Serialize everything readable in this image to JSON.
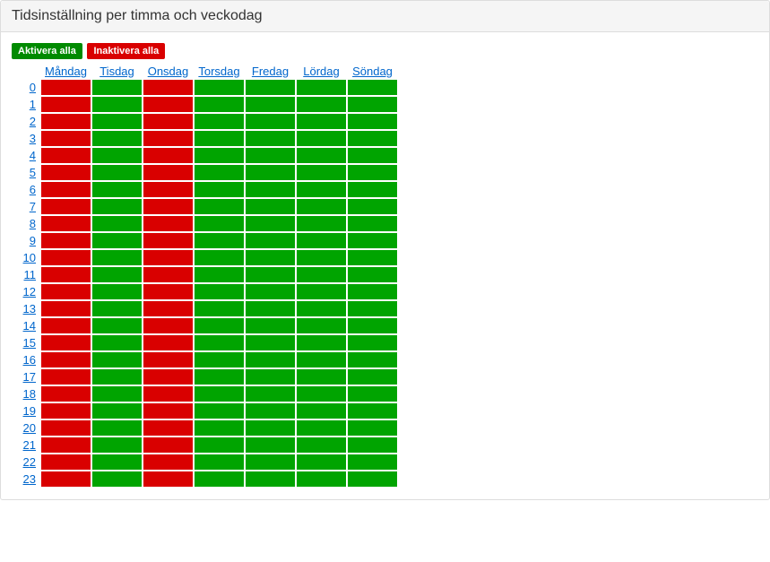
{
  "panel": {
    "title": "Tidsinställning per timma och veckodag"
  },
  "buttons": {
    "activate_all": "Aktivera alla",
    "deactivate_all": "Inaktivera alla"
  },
  "days": [
    "Måndag",
    "Tisdag",
    "Onsdag",
    "Torsdag",
    "Fredag",
    "Lördag",
    "Söndag"
  ],
  "hours": [
    "0",
    "1",
    "2",
    "3",
    "4",
    "5",
    "6",
    "7",
    "8",
    "9",
    "10",
    "11",
    "12",
    "13",
    "14",
    "15",
    "16",
    "17",
    "18",
    "19",
    "20",
    "21",
    "22",
    "23"
  ],
  "day_active": [
    false,
    true,
    false,
    true,
    true,
    true,
    true
  ],
  "colors": {
    "active": "#00a400",
    "inactive": "#d90000"
  }
}
